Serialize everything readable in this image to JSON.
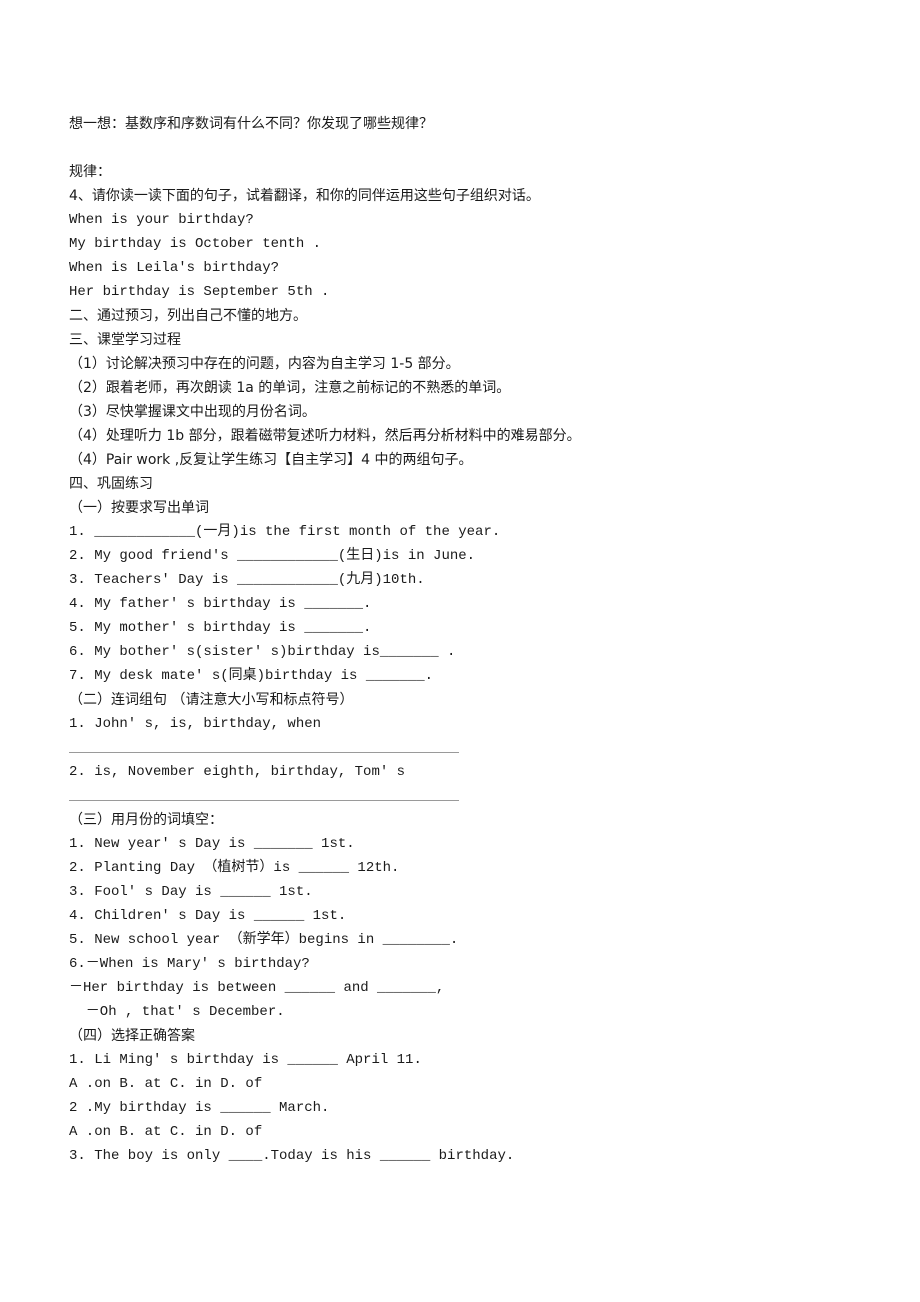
{
  "think_prompt": "想一想：基数序和序数词有什么不同？你发现了哪些规律？",
  "rule_label": "规律：",
  "task4": {
    "instruction": "4、请你读一读下面的句子，试着翻译，和你的同伴运用这些句子组织对话。",
    "sentences": [
      "When is your birthday?",
      "My birthday is October tenth .",
      "When is Leila's birthday?",
      "Her birthday is September 5th ."
    ]
  },
  "section2": "二、通过预习，列出自己不懂的地方。",
  "section3": {
    "title": "三、课堂学习过程",
    "steps": [
      "（1）讨论解决预习中存在的问题，内容为自主学习 1-5 部分。",
      "（2）跟着老师，再次朗读 1a 的单词，注意之前标记的不熟悉的单词。",
      "（3）尽快掌握课文中出现的月份名词。",
      "（4）处理听力 1b 部分，跟着磁带复述听力材料，然后再分析材料中的难易部分。",
      "（4）Pair work ,反复让学生练习【自主学习】4 中的两组句子。"
    ]
  },
  "section4": {
    "title": "四、巩固练习",
    "part1": {
      "title": "（一）按要求写出单词",
      "items": [
        "1. ____________(一月)is the first month of the year.",
        "2. My good friend's ____________(生日)is in June.",
        "3. Teachers' Day is ____________(九月)10th.",
        "4. My father' s birthday is _______.",
        "5. My mother' s birthday is _______.",
        "6. My bother' s(sister' s)birthday is_______ .",
        "7. My desk mate' s(同桌)birthday is _______."
      ]
    },
    "part2": {
      "title": "（二）连词组句 （请注意大小写和标点符号）",
      "items": [
        "1. John' s, is, birthday, when",
        "2. is, November eighth, birthday, Tom' s"
      ]
    },
    "part3": {
      "title": "（三）用月份的词填空：",
      "items": [
        "1. New year' s Day is _______ 1st.",
        "2. Planting Day （植树节）is ______ 12th.",
        "3. Fool' s Day is ______ 1st.",
        "4. Children' s Day is ______ 1st.",
        "5. New school year （新学年）begins in ________.",
        "6.－When is Mary' s birthday?",
        "－Her birthday is between ______ and _______,",
        "  －Oh , that' s December."
      ]
    },
    "part4": {
      "title": "（四）选择正确答案",
      "items": [
        "1. Li Ming' s birthday is ______ April 11.",
        "A .on B. at C. in D. of",
        "2 .My birthday is ______ March.",
        "A .on B. at C. in D. of",
        "3. The boy is only ____.Today is his ______ birthday."
      ]
    }
  }
}
